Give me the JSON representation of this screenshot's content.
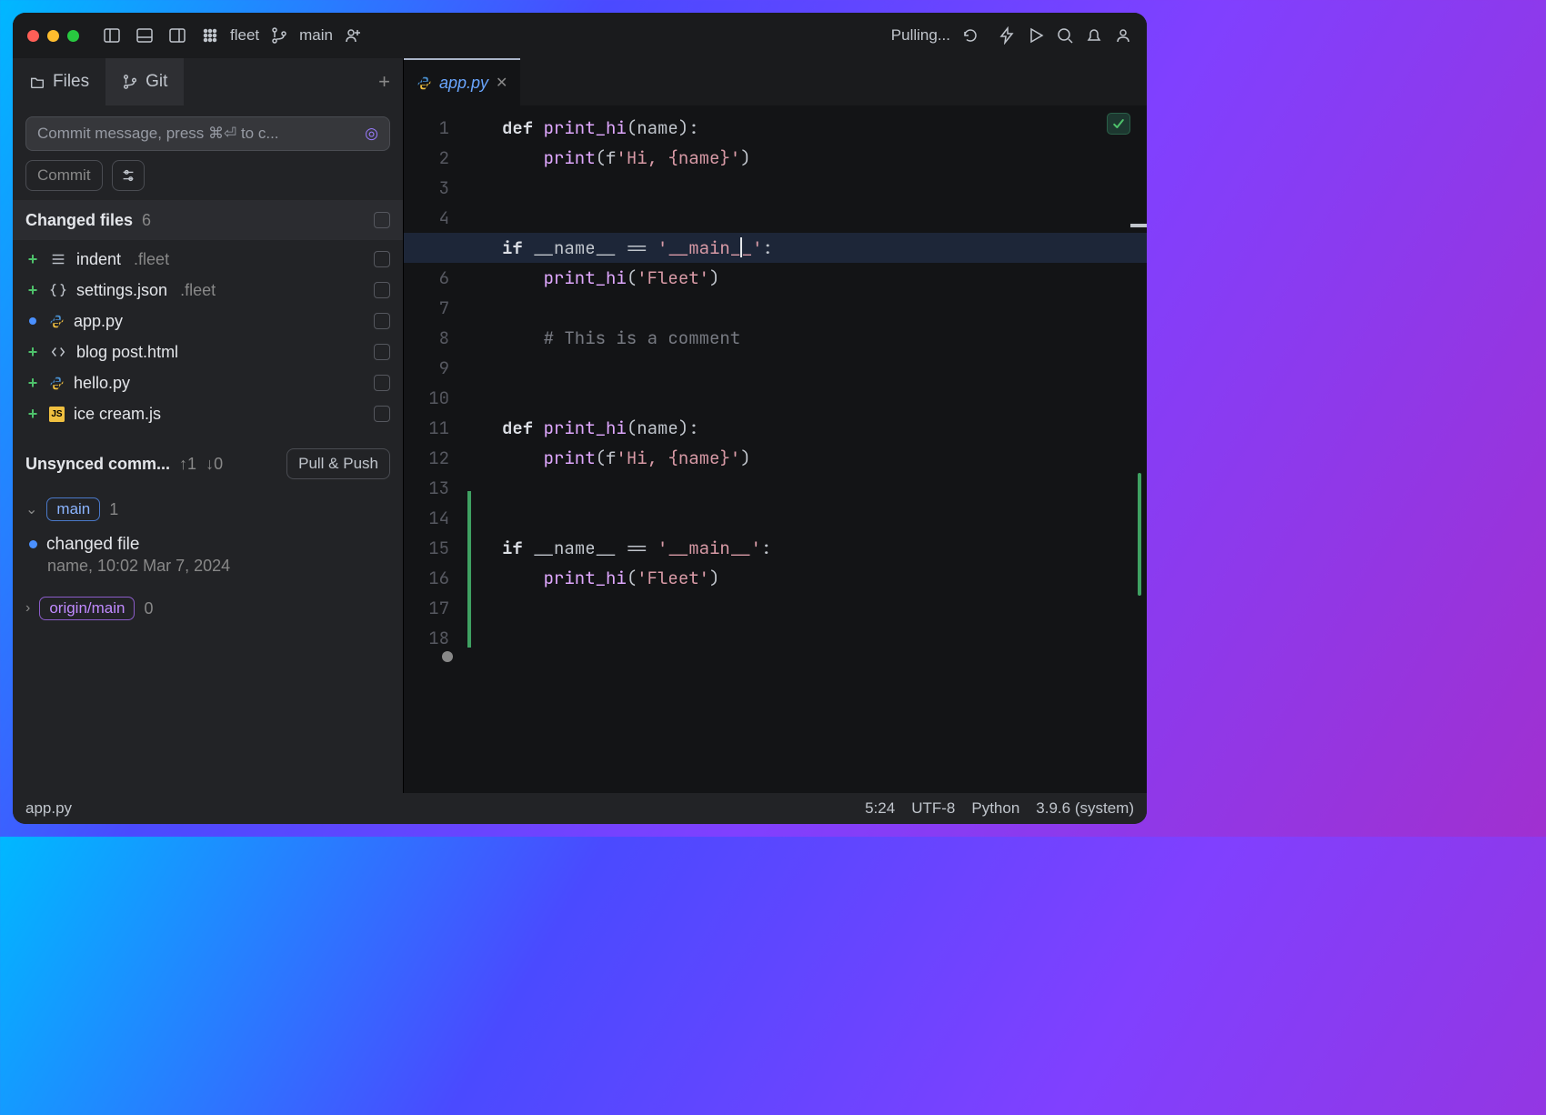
{
  "titlebar": {
    "project": "fleet",
    "branch": "main",
    "status_text": "Pulling..."
  },
  "sidebar_tabs": {
    "files_label": "Files",
    "git_label": "Git"
  },
  "commit": {
    "placeholder": "Commit message, press ⌘⏎ to c...",
    "button_label": "Commit"
  },
  "changed": {
    "title": "Changed files",
    "count": "6",
    "files": [
      {
        "status": "add",
        "icon": "indent",
        "name": "indent",
        "dir": ".fleet"
      },
      {
        "status": "add",
        "icon": "json",
        "name": "settings.json",
        "dir": ".fleet"
      },
      {
        "status": "mod",
        "icon": "py",
        "name": "app.py",
        "dir": ""
      },
      {
        "status": "add",
        "icon": "html",
        "name": "blog post.html",
        "dir": ""
      },
      {
        "status": "add",
        "icon": "py",
        "name": "hello.py",
        "dir": ""
      },
      {
        "status": "add",
        "icon": "js",
        "name": "ice cream.js",
        "dir": ""
      }
    ]
  },
  "unsynced": {
    "title": "Unsynced comm...",
    "up": "↑1",
    "down": "↓0",
    "pull_push": "Pull & Push",
    "branches": [
      {
        "name": "main",
        "style": "blue",
        "count": "1",
        "expanded": true
      },
      {
        "name": "origin/main",
        "style": "purple",
        "count": "0",
        "expanded": false
      }
    ],
    "commit_msg": "changed file",
    "commit_meta": "name, 10:02 Mar 7, 2024"
  },
  "editor": {
    "tab_filename": "app.py",
    "lines": [
      [
        [
          "kw",
          "def "
        ],
        [
          "fn",
          "print_hi"
        ],
        [
          "",
          "(name):"
        ]
      ],
      [
        [
          "",
          "    "
        ],
        [
          "fn",
          "print"
        ],
        [
          "",
          "(f"
        ],
        [
          "str",
          "'Hi, {name}'"
        ],
        [
          "",
          ")"
        ]
      ],
      [],
      [],
      [
        [
          "kw",
          "if"
        ],
        [
          "",
          " __name__ == "
        ],
        [
          "str",
          "'__main_"
        ],
        [
          "cursor",
          ""
        ],
        [
          "str",
          "_'"
        ],
        [
          "",
          ":"
        ]
      ],
      [
        [
          "",
          "    "
        ],
        [
          "fn",
          "print_hi"
        ],
        [
          "",
          "("
        ],
        [
          "str",
          "'Fleet'"
        ],
        [
          "",
          ")"
        ]
      ],
      [],
      [
        [
          "",
          "    "
        ],
        [
          "cmt",
          "# This is a comment"
        ]
      ],
      [],
      [],
      [
        [
          "kw",
          "def "
        ],
        [
          "fn",
          "print_hi"
        ],
        [
          "",
          "(name):"
        ]
      ],
      [
        [
          "",
          "    "
        ],
        [
          "fn",
          "print"
        ],
        [
          "",
          "(f"
        ],
        [
          "str",
          "'Hi, {name}'"
        ],
        [
          "",
          ")"
        ]
      ],
      [],
      [],
      [
        [
          "kw",
          "if"
        ],
        [
          "",
          " __name__ == "
        ],
        [
          "str",
          "'__main__'"
        ],
        [
          "",
          ":"
        ]
      ],
      [
        [
          "",
          "    "
        ],
        [
          "fn",
          "print_hi"
        ],
        [
          "",
          "("
        ],
        [
          "str",
          "'Fleet'"
        ],
        [
          "",
          ")"
        ]
      ],
      [],
      []
    ],
    "highlight_line": 5
  },
  "status": {
    "filename": "app.py",
    "cursor": "5:24",
    "encoding": "UTF-8",
    "lang": "Python",
    "interpreter": "3.9.6 (system)"
  }
}
